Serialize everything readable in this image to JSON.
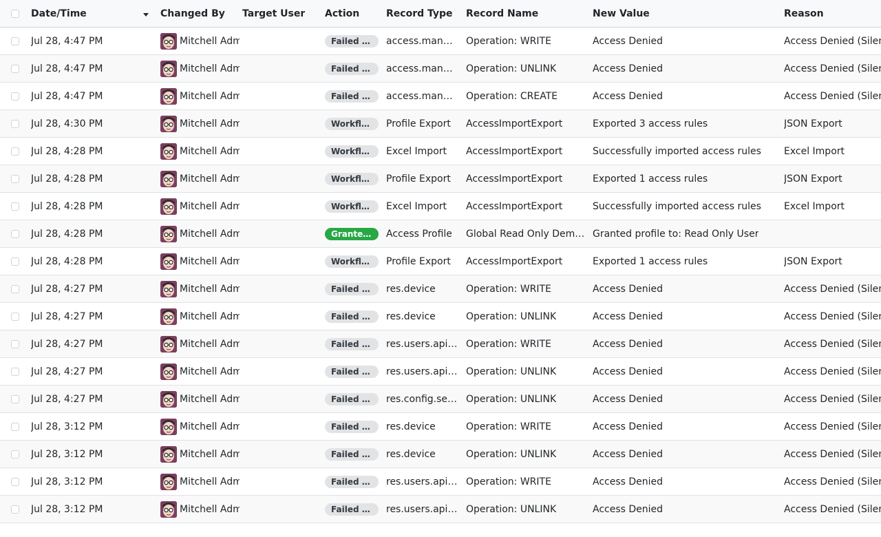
{
  "headers": {
    "date": "Date/Time",
    "changed_by": "Changed By",
    "target_user": "Target User",
    "action": "Action",
    "record_type": "Record Type",
    "record_name": "Record Name",
    "new_value": "New Value",
    "reason": "Reason"
  },
  "colors": {
    "badge_default": "#e2e3e5",
    "badge_success": "#28a745",
    "avatar": "#7b3f5f"
  },
  "rows": [
    {
      "date": "Jul 28, 4:47 PM",
      "changed_by": "Mitchell Admin",
      "target_user": "",
      "action": "Failed Access",
      "action_style": "default",
      "record_type": "access.management",
      "record_name": "Operation: WRITE",
      "new_value": "Access Denied",
      "reason": "Access Denied (Silent)"
    },
    {
      "date": "Jul 28, 4:47 PM",
      "changed_by": "Mitchell Admin",
      "target_user": "",
      "action": "Failed Access",
      "action_style": "default",
      "record_type": "access.management",
      "record_name": "Operation: UNLINK",
      "new_value": "Access Denied",
      "reason": "Access Denied (Silent)"
    },
    {
      "date": "Jul 28, 4:47 PM",
      "changed_by": "Mitchell Admin",
      "target_user": "",
      "action": "Failed Access",
      "action_style": "default",
      "record_type": "access.management",
      "record_name": "Operation: CREATE",
      "new_value": "Access Denied",
      "reason": "Access Denied (Silent)"
    },
    {
      "date": "Jul 28, 4:30 PM",
      "changed_by": "Mitchell Admin",
      "target_user": "",
      "action": "Workflow",
      "action_style": "default",
      "record_type": "Profile Export",
      "record_name": "AccessImportExport",
      "new_value": "Exported 3 access rules",
      "reason": "JSON Export"
    },
    {
      "date": "Jul 28, 4:28 PM",
      "changed_by": "Mitchell Admin",
      "target_user": "",
      "action": "Workflow",
      "action_style": "default",
      "record_type": "Excel Import",
      "record_name": "AccessImportExport",
      "new_value": "Successfully imported access rules",
      "reason": "Excel Import"
    },
    {
      "date": "Jul 28, 4:28 PM",
      "changed_by": "Mitchell Admin",
      "target_user": "",
      "action": "Workflow",
      "action_style": "default",
      "record_type": "Profile Export",
      "record_name": "AccessImportExport",
      "new_value": "Exported 1 access rules",
      "reason": "JSON Export"
    },
    {
      "date": "Jul 28, 4:28 PM",
      "changed_by": "Mitchell Admin",
      "target_user": "",
      "action": "Workflow",
      "action_style": "default",
      "record_type": "Excel Import",
      "record_name": "AccessImportExport",
      "new_value": "Successfully imported access rules",
      "reason": "Excel Import"
    },
    {
      "date": "Jul 28, 4:28 PM",
      "changed_by": "Mitchell Admin",
      "target_user": "",
      "action": "Granted Profile",
      "action_style": "success",
      "record_type": "Access Profile",
      "record_name": "Global Read Only Demo (Profile)",
      "new_value": "Granted profile to: Read Only User",
      "reason": ""
    },
    {
      "date": "Jul 28, 4:28 PM",
      "changed_by": "Mitchell Admin",
      "target_user": "",
      "action": "Workflow",
      "action_style": "default",
      "record_type": "Profile Export",
      "record_name": "AccessImportExport",
      "new_value": "Exported 1 access rules",
      "reason": "JSON Export"
    },
    {
      "date": "Jul 28, 4:27 PM",
      "changed_by": "Mitchell Admin",
      "target_user": "",
      "action": "Failed Access",
      "action_style": "default",
      "record_type": "res.device",
      "record_name": "Operation: WRITE",
      "new_value": "Access Denied",
      "reason": "Access Denied (Silent)"
    },
    {
      "date": "Jul 28, 4:27 PM",
      "changed_by": "Mitchell Admin",
      "target_user": "",
      "action": "Failed Access",
      "action_style": "default",
      "record_type": "res.device",
      "record_name": "Operation: UNLINK",
      "new_value": "Access Denied",
      "reason": "Access Denied (Silent)"
    },
    {
      "date": "Jul 28, 4:27 PM",
      "changed_by": "Mitchell Admin",
      "target_user": "",
      "action": "Failed Access",
      "action_style": "default",
      "record_type": "res.users.apikeys",
      "record_name": "Operation: WRITE",
      "new_value": "Access Denied",
      "reason": "Access Denied (Silent)"
    },
    {
      "date": "Jul 28, 4:27 PM",
      "changed_by": "Mitchell Admin",
      "target_user": "",
      "action": "Failed Access",
      "action_style": "default",
      "record_type": "res.users.apikeys",
      "record_name": "Operation: UNLINK",
      "new_value": "Access Denied",
      "reason": "Access Denied (Silent)"
    },
    {
      "date": "Jul 28, 4:27 PM",
      "changed_by": "Mitchell Admin",
      "target_user": "",
      "action": "Failed Access",
      "action_style": "default",
      "record_type": "res.config.settings",
      "record_name": "Operation: UNLINK",
      "new_value": "Access Denied",
      "reason": "Access Denied (Silent)"
    },
    {
      "date": "Jul 28, 3:12 PM",
      "changed_by": "Mitchell Admin",
      "target_user": "",
      "action": "Failed Access",
      "action_style": "default",
      "record_type": "res.device",
      "record_name": "Operation: WRITE",
      "new_value": "Access Denied",
      "reason": "Access Denied (Silent)"
    },
    {
      "date": "Jul 28, 3:12 PM",
      "changed_by": "Mitchell Admin",
      "target_user": "",
      "action": "Failed Access",
      "action_style": "default",
      "record_type": "res.device",
      "record_name": "Operation: UNLINK",
      "new_value": "Access Denied",
      "reason": "Access Denied (Silent)"
    },
    {
      "date": "Jul 28, 3:12 PM",
      "changed_by": "Mitchell Admin",
      "target_user": "",
      "action": "Failed Access",
      "action_style": "default",
      "record_type": "res.users.apikeys",
      "record_name": "Operation: WRITE",
      "new_value": "Access Denied",
      "reason": "Access Denied (Silent)"
    },
    {
      "date": "Jul 28, 3:12 PM",
      "changed_by": "Mitchell Admin",
      "target_user": "",
      "action": "Failed Access",
      "action_style": "default",
      "record_type": "res.users.apikeys",
      "record_name": "Operation: UNLINK",
      "new_value": "Access Denied",
      "reason": "Access Denied (Silent)"
    }
  ]
}
